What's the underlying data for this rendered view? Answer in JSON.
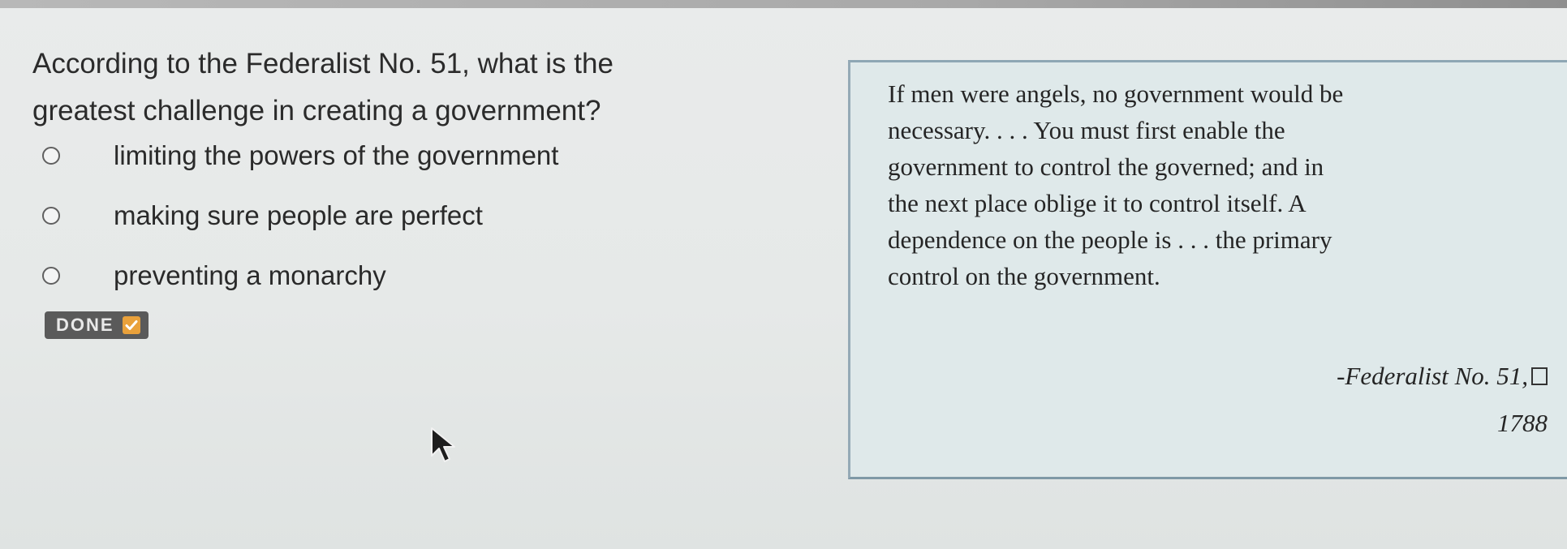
{
  "question": {
    "lines": [
      "According to the Federalist No. 51, what is the",
      "greatest challenge in creating a government?"
    ]
  },
  "options": [
    {
      "label": "limiting the powers of the government",
      "selected": false
    },
    {
      "label": "making sure people are perfect",
      "selected": false
    },
    {
      "label": "preventing a monarchy",
      "selected": false
    }
  ],
  "done_button": {
    "label": "DONE",
    "icon": "checkmark-icon",
    "accent_color": "#e9a13b"
  },
  "quote": {
    "lines": [
      "If men were angels, no government would be",
      "necessary. . . . You must first enable the",
      "government to control the governed; and in",
      "the next place oblige it to control itself. A",
      "dependence on the people is . . . the primary",
      "control on the government."
    ],
    "source": "-Federalist No. 51,",
    "year": "1788"
  },
  "icons": {
    "cursor": "mouse-pointer-icon",
    "placeholder_box": "square-box-icon"
  }
}
